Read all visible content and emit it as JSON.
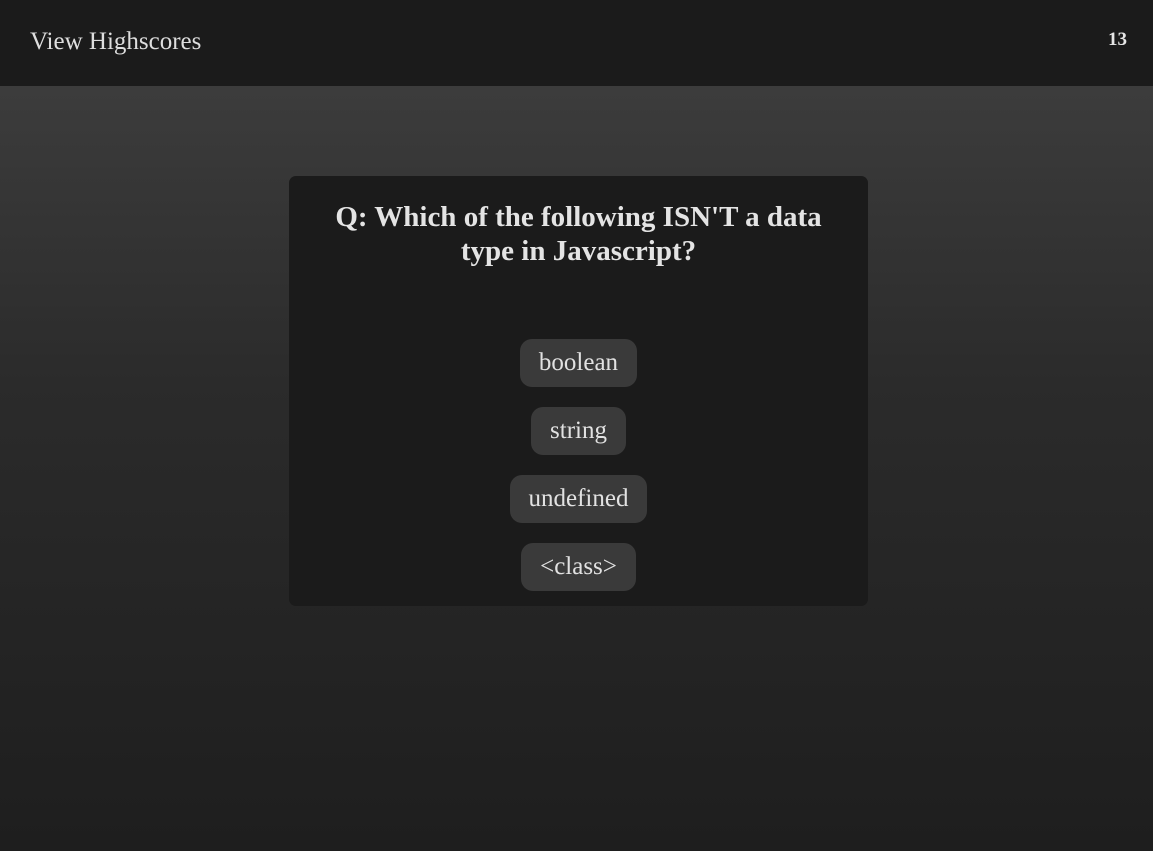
{
  "header": {
    "highscores_label": "View Highscores",
    "timer_value": "13"
  },
  "quiz": {
    "question": "Q: Which of the following ISN'T a data type in Javascript?",
    "answers": [
      {
        "label": "boolean"
      },
      {
        "label": "string"
      },
      {
        "label": "undefined"
      },
      {
        "label": "<class>"
      }
    ]
  },
  "colors": {
    "header_bg": "#1b1b1b",
    "card_bg": "#1b1b1b",
    "button_bg": "#3a3a3a",
    "text": "#e2e2e2"
  }
}
